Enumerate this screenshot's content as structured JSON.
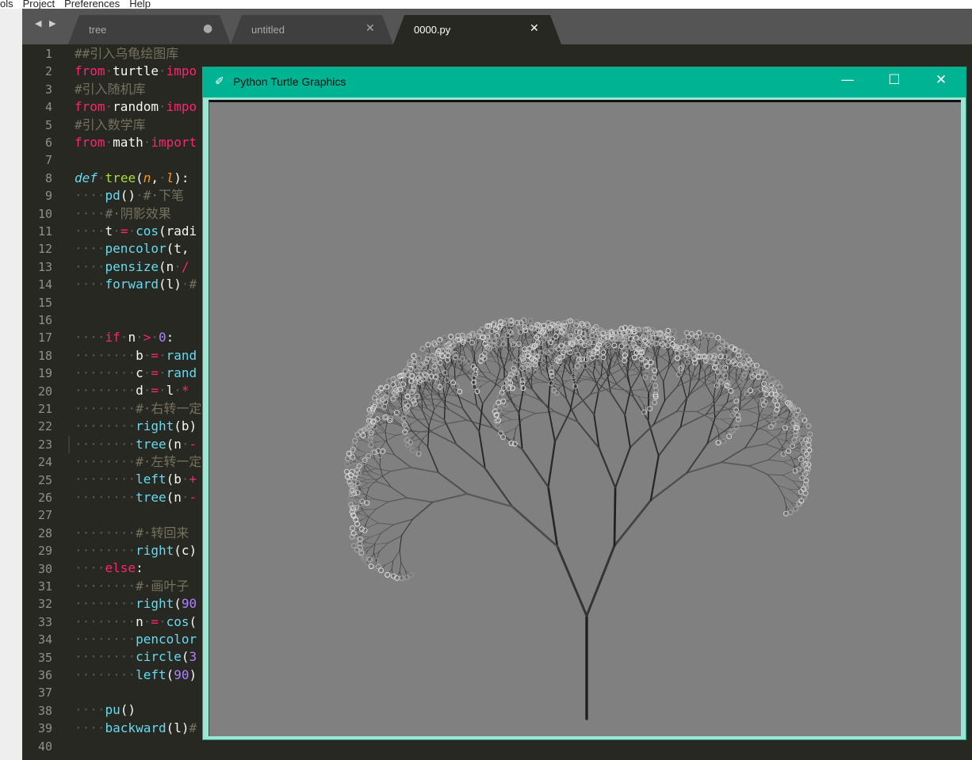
{
  "menu": [
    "ols",
    "Project",
    "Preferences",
    "Help"
  ],
  "nav_arrows": "◀ ▶",
  "tabs": [
    {
      "label": "tree",
      "close": "●"
    },
    {
      "label": "untitled",
      "close": "✕"
    },
    {
      "label": "0000.py",
      "close": "✕"
    }
  ],
  "active_line": 23,
  "line_numbers": [
    "1",
    "2",
    "3",
    "4",
    "5",
    "6",
    "7",
    "8",
    "9",
    "10",
    "11",
    "12",
    "13",
    "14",
    "15",
    "16",
    "17",
    "18",
    "19",
    "20",
    "21",
    "22",
    "23",
    "24",
    "25",
    "26",
    "27",
    "28",
    "29",
    "30",
    "31",
    "32",
    "33",
    "34",
    "35",
    "36",
    "37",
    "38",
    "39",
    "40"
  ],
  "code_lines": [
    [
      [
        "cm",
        "##引入乌龟绘图库"
      ]
    ],
    [
      [
        "kw",
        "from"
      ],
      [
        "ws",
        "·"
      ],
      [
        "",
        "turtle"
      ],
      [
        "ws",
        "·"
      ],
      [
        "kw",
        "impo"
      ]
    ],
    [
      [
        "cm",
        "#引入随机库"
      ]
    ],
    [
      [
        "kw",
        "from"
      ],
      [
        "ws",
        "·"
      ],
      [
        "",
        "random"
      ],
      [
        "ws",
        "·"
      ],
      [
        "kw",
        "impo"
      ]
    ],
    [
      [
        "cm",
        "#引入数学库"
      ]
    ],
    [
      [
        "kw",
        "from"
      ],
      [
        "ws",
        "·"
      ],
      [
        "",
        "math"
      ],
      [
        "ws",
        "·"
      ],
      [
        "kw",
        "import"
      ]
    ],
    [],
    [
      [
        "it",
        "def"
      ],
      [
        "ws",
        "·"
      ],
      [
        "fn",
        "tree"
      ],
      [
        "",
        "("
      ],
      [
        "pa",
        "n"
      ],
      [
        "",
        ","
      ],
      [
        "ws",
        "·"
      ],
      [
        "pa",
        "l"
      ],
      [
        "",
        "):"
      ]
    ],
    [
      [
        "ws",
        "····"
      ],
      [
        "bi",
        "pd"
      ],
      [
        "",
        "()"
      ],
      [
        "ws",
        "·"
      ],
      [
        "cm",
        "#·下笔"
      ]
    ],
    [
      [
        "ws",
        "····"
      ],
      [
        "cm",
        "#·阴影效果"
      ]
    ],
    [
      [
        "ws",
        "····"
      ],
      [
        "",
        "t"
      ],
      [
        "ws",
        "·"
      ],
      [
        "kw",
        "="
      ],
      [
        "ws",
        "·"
      ],
      [
        "bi",
        "cos"
      ],
      [
        "",
        "(radi"
      ]
    ],
    [
      [
        "ws",
        "····"
      ],
      [
        "bi",
        "pencolor"
      ],
      [
        "",
        "(t,"
      ]
    ],
    [
      [
        "ws",
        "····"
      ],
      [
        "bi",
        "pensize"
      ],
      [
        "",
        "(n"
      ],
      [
        "ws",
        "·"
      ],
      [
        "kw",
        "/"
      ]
    ],
    [
      [
        "ws",
        "····"
      ],
      [
        "bi",
        "forward"
      ],
      [
        "",
        "(l)"
      ],
      [
        "ws",
        "·"
      ],
      [
        "cm",
        "#"
      ]
    ],
    [],
    [],
    [
      [
        "ws",
        "····"
      ],
      [
        "kw",
        "if"
      ],
      [
        "ws",
        "·"
      ],
      [
        "",
        "n"
      ],
      [
        "ws",
        "·"
      ],
      [
        "kw",
        ">"
      ],
      [
        "ws",
        "·"
      ],
      [
        "num",
        "0"
      ],
      [
        "",
        ":"
      ]
    ],
    [
      [
        "ws",
        "········"
      ],
      [
        "",
        "b"
      ],
      [
        "ws",
        "·"
      ],
      [
        "kw",
        "="
      ],
      [
        "ws",
        "·"
      ],
      [
        "bi",
        "rand"
      ]
    ],
    [
      [
        "ws",
        "········"
      ],
      [
        "",
        "c"
      ],
      [
        "ws",
        "·"
      ],
      [
        "kw",
        "="
      ],
      [
        "ws",
        "·"
      ],
      [
        "bi",
        "rand"
      ]
    ],
    [
      [
        "ws",
        "········"
      ],
      [
        "",
        "d"
      ],
      [
        "ws",
        "·"
      ],
      [
        "kw",
        "="
      ],
      [
        "ws",
        "·"
      ],
      [
        "",
        "l"
      ],
      [
        "ws",
        "·"
      ],
      [
        "kw",
        "*"
      ]
    ],
    [
      [
        "ws",
        "········"
      ],
      [
        "cm",
        "#·右转一定"
      ]
    ],
    [
      [
        "ws",
        "········"
      ],
      [
        "bi",
        "right"
      ],
      [
        "",
        "(b)"
      ]
    ],
    [
      [
        "ws",
        "········"
      ],
      [
        "bi",
        "tree"
      ],
      [
        "",
        "(n"
      ],
      [
        "ws",
        "·"
      ],
      [
        "kw",
        "-"
      ]
    ],
    [
      [
        "ws",
        "········"
      ],
      [
        "cm",
        "#·左转一定"
      ]
    ],
    [
      [
        "ws",
        "········"
      ],
      [
        "bi",
        "left"
      ],
      [
        "",
        "(b"
      ],
      [
        "ws",
        "·"
      ],
      [
        "kw",
        "+"
      ]
    ],
    [
      [
        "ws",
        "········"
      ],
      [
        "bi",
        "tree"
      ],
      [
        "",
        "(n"
      ],
      [
        "ws",
        "·"
      ],
      [
        "kw",
        "-"
      ]
    ],
    [],
    [
      [
        "ws",
        "········"
      ],
      [
        "cm",
        "#·转回来"
      ]
    ],
    [
      [
        "ws",
        "········"
      ],
      [
        "bi",
        "right"
      ],
      [
        "",
        "(c)"
      ]
    ],
    [
      [
        "ws",
        "····"
      ],
      [
        "kw",
        "else"
      ],
      [
        "",
        ":"
      ]
    ],
    [
      [
        "ws",
        "········"
      ],
      [
        "cm",
        "#·画叶子"
      ]
    ],
    [
      [
        "ws",
        "········"
      ],
      [
        "bi",
        "right"
      ],
      [
        "",
        "("
      ],
      [
        "num",
        "90"
      ]
    ],
    [
      [
        "ws",
        "········"
      ],
      [
        "",
        "n"
      ],
      [
        "ws",
        "·"
      ],
      [
        "kw",
        "="
      ],
      [
        "ws",
        "·"
      ],
      [
        "bi",
        "cos"
      ],
      [
        "",
        "("
      ]
    ],
    [
      [
        "ws",
        "········"
      ],
      [
        "bi",
        "pencolor"
      ]
    ],
    [
      [
        "ws",
        "········"
      ],
      [
        "bi",
        "circle"
      ],
      [
        "",
        "("
      ],
      [
        "num",
        "3"
      ]
    ],
    [
      [
        "ws",
        "········"
      ],
      [
        "bi",
        "left"
      ],
      [
        "",
        "("
      ],
      [
        "num",
        "90"
      ],
      [
        "",
        ")"
      ]
    ],
    [],
    [
      [
        "ws",
        "····"
      ],
      [
        "bi",
        "pu"
      ],
      [
        "",
        "()"
      ]
    ],
    [
      [
        "ws",
        "····"
      ],
      [
        "bi",
        "backward"
      ],
      [
        "",
        "(l)"
      ],
      [
        "cm",
        "#"
      ]
    ],
    []
  ],
  "turtle_window": {
    "title": "Python Turtle Graphics",
    "feather_icon": "✐",
    "minimize": "—",
    "maximize": "☐",
    "close": "✕"
  },
  "colors": {
    "editor_bg": "#272822",
    "turtle_title_bg": "#00b392",
    "canvas_bg": "#808080",
    "keyword": "#f92672"
  }
}
